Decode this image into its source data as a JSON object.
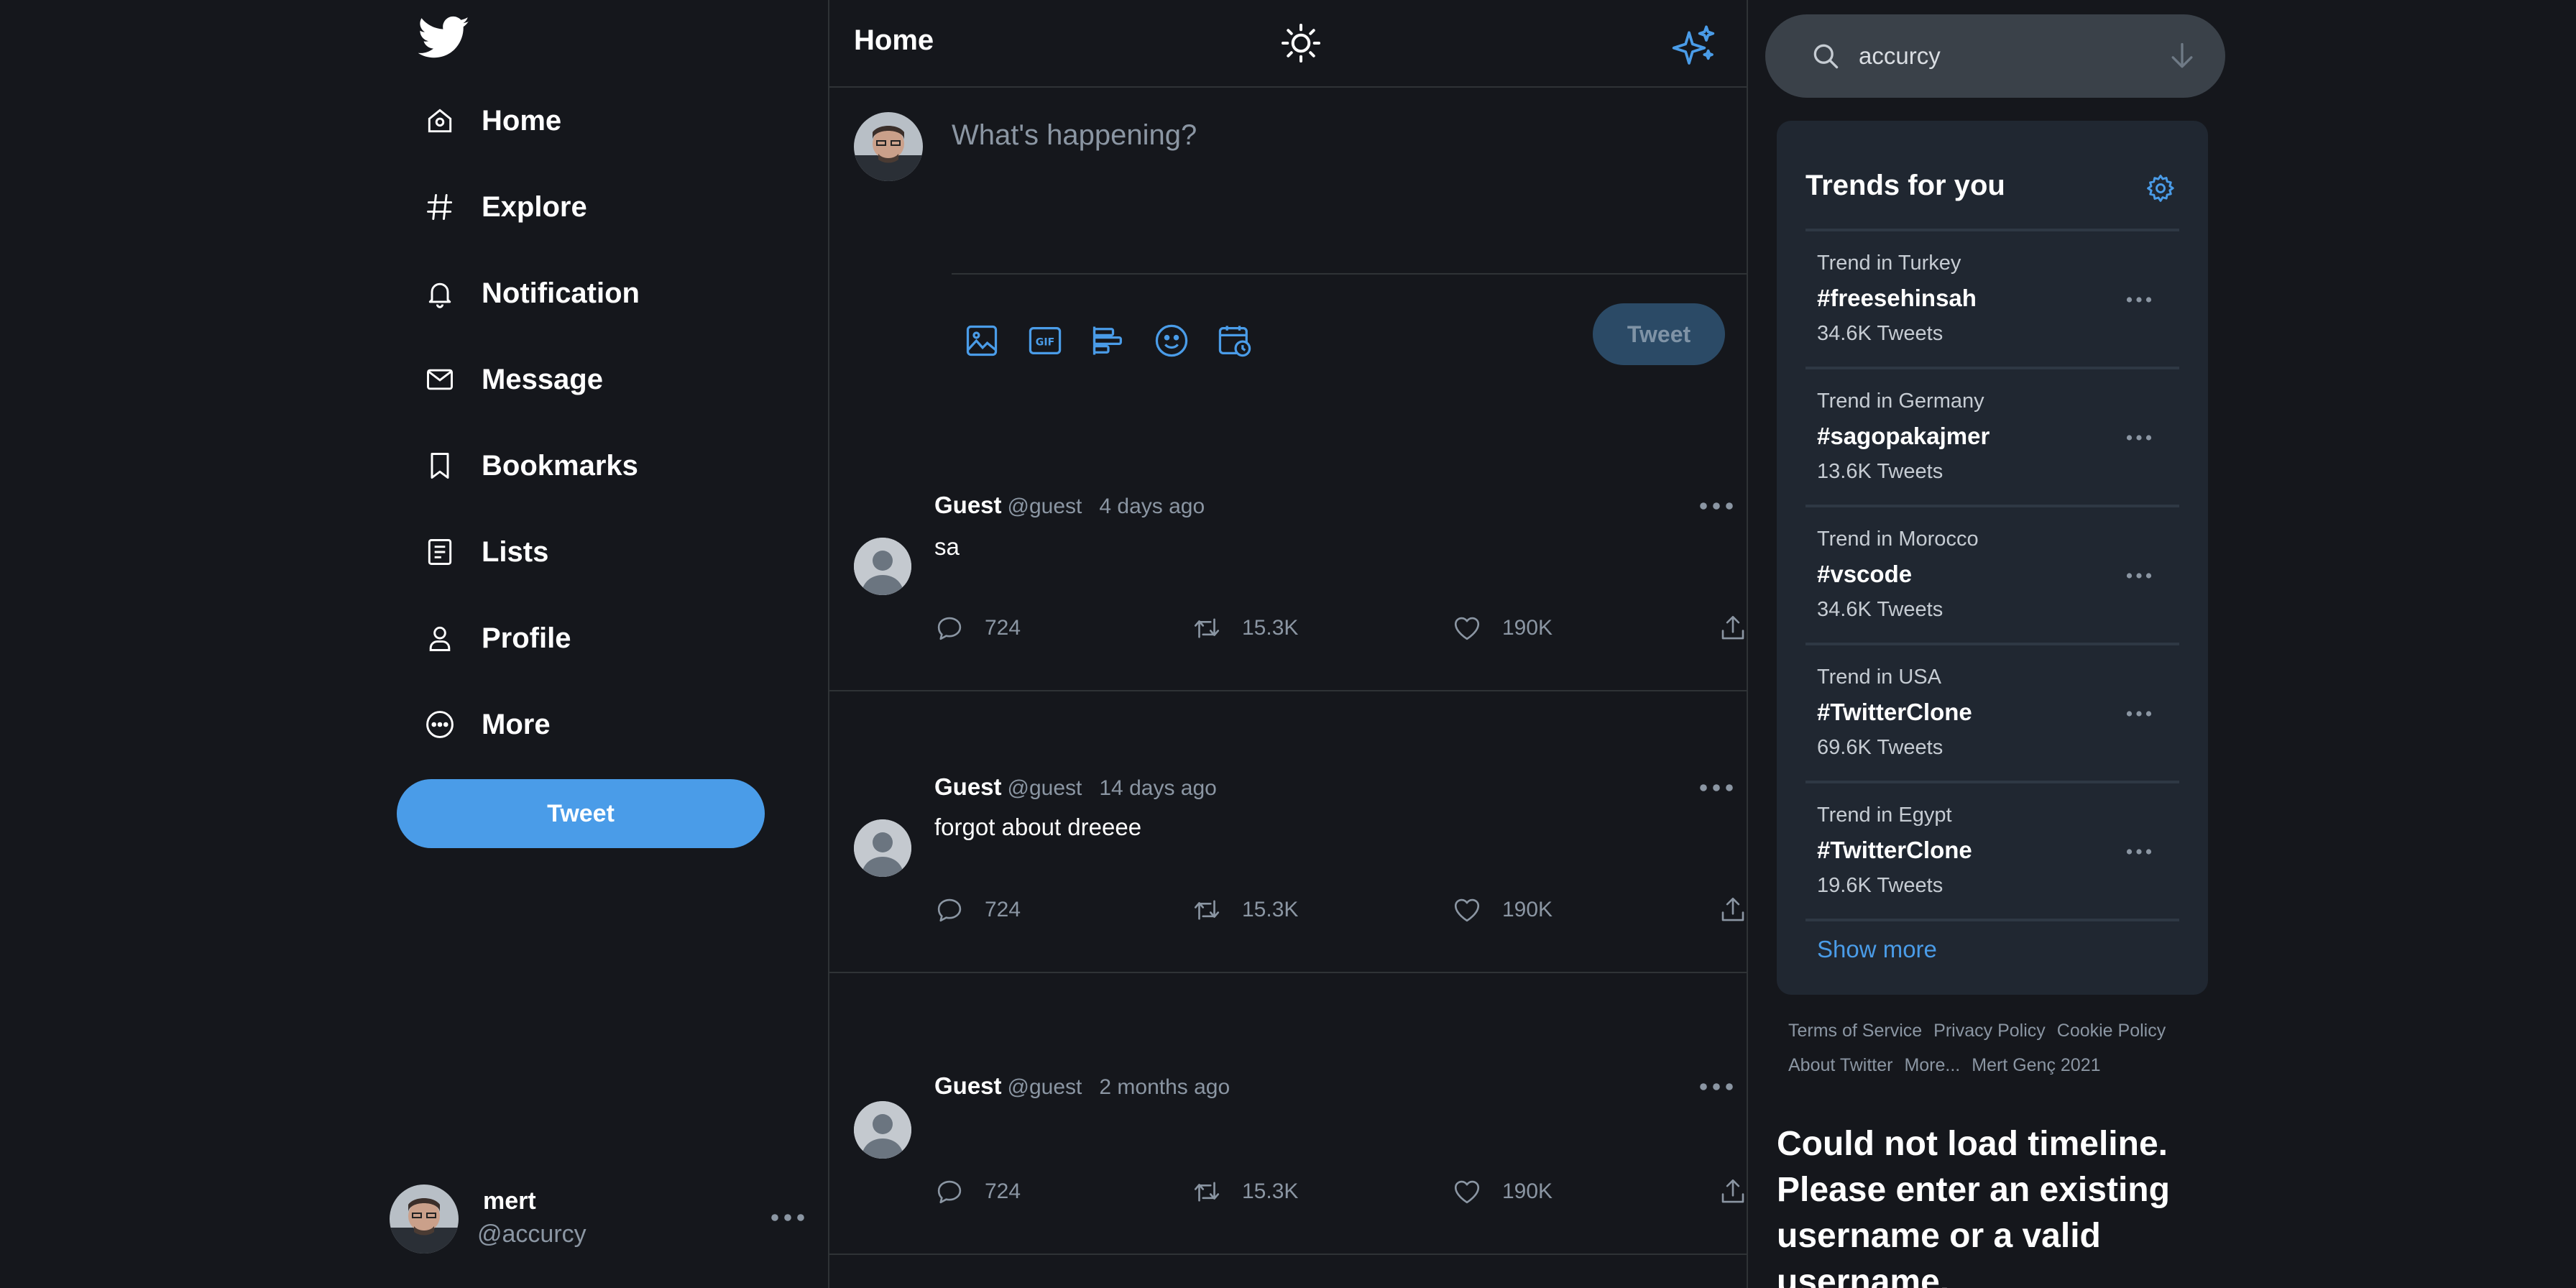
{
  "sidebar": {
    "logo": "twitter-bird-icon",
    "items": [
      {
        "label": "Home",
        "icon": "home-icon"
      },
      {
        "label": "Explore",
        "icon": "hashtag-icon"
      },
      {
        "label": "Notification",
        "icon": "bell-icon"
      },
      {
        "label": "Message",
        "icon": "mail-icon"
      },
      {
        "label": "Bookmarks",
        "icon": "bookmark-icon"
      },
      {
        "label": "Lists",
        "icon": "list-icon"
      },
      {
        "label": "Profile",
        "icon": "user-icon"
      },
      {
        "label": "More",
        "icon": "more-circle-icon"
      }
    ],
    "tweet_label": "Tweet",
    "account": {
      "name": "mert",
      "handle": "@accurcy"
    }
  },
  "main": {
    "title": "Home",
    "composer": {
      "placeholder": "What's happening?",
      "tweet_label": "Tweet"
    },
    "tweets": [
      {
        "name": "Guest",
        "handle": "@guest",
        "time": "4 days ago",
        "text": "sa",
        "replies": "724",
        "retweets": "15.3K",
        "likes": "190K"
      },
      {
        "name": "Guest",
        "handle": "@guest",
        "time": "14 days ago",
        "text": "forgot about dreeee",
        "replies": "724",
        "retweets": "15.3K",
        "likes": "190K"
      },
      {
        "name": "Guest",
        "handle": "@guest",
        "time": "2 months ago",
        "text": "",
        "replies": "724",
        "retweets": "15.3K",
        "likes": "190K"
      }
    ]
  },
  "search": {
    "value": "accurcy"
  },
  "trends": {
    "title": "Trends for you",
    "items": [
      {
        "location": "Trend in Turkey",
        "tag": "#freesehinsah",
        "count": "34.6K Tweets"
      },
      {
        "location": "Trend in Germany",
        "tag": "#sagopakajmer",
        "count": "13.6K Tweets"
      },
      {
        "location": "Trend in Morocco",
        "tag": "#vscode",
        "count": "34.6K Tweets"
      },
      {
        "location": "Trend in USA",
        "tag": "#TwitterClone",
        "count": "69.6K Tweets"
      },
      {
        "location": "Trend in Egypt",
        "tag": "#TwitterClone",
        "count": "19.6K Tweets"
      }
    ],
    "show_more": "Show more"
  },
  "footer": {
    "links": [
      "Terms of Service",
      "Privacy Policy",
      "Cookie Policy",
      "About Twitter",
      "More...",
      "Mert Genç 2021"
    ]
  },
  "error": "Could not load timeline. Please enter an existing username or a valid username.",
  "colors": {
    "background": "#15171c",
    "accent": "#4a9ce8",
    "panel": "#202731",
    "muted": "#8b96a3"
  }
}
